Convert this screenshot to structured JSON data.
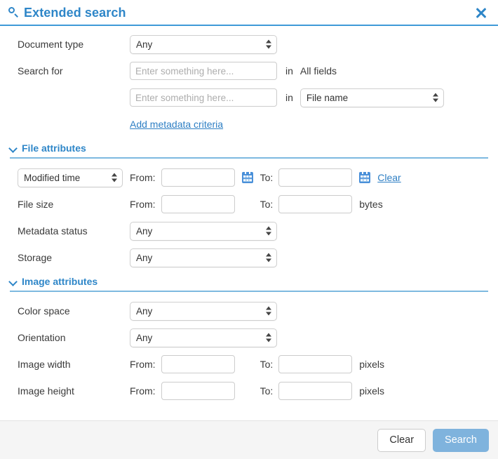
{
  "header": {
    "title": "Extended search",
    "search_icon": "search-icon",
    "close_icon": "close-icon"
  },
  "form": {
    "document_type": {
      "label": "Document type",
      "value": "Any"
    },
    "search_for": {
      "label": "Search for",
      "in_label": "in",
      "row1": {
        "placeholder": "Enter something here...",
        "value": "",
        "field_scope": "All fields"
      },
      "row2": {
        "placeholder": "Enter something here...",
        "value": "",
        "field_scope": "File name"
      },
      "add_criteria_link": "Add metadata criteria"
    }
  },
  "file_attributes": {
    "section_title": "File attributes",
    "chevron_icon": "chevron-down-icon",
    "date": {
      "field_value": "Modified time",
      "from_label": "From:",
      "from_value": "",
      "to_label": "To:",
      "to_value": "",
      "clear_link": "Clear",
      "calendar_icon": "calendar-icon"
    },
    "file_size": {
      "label": "File size",
      "from_label": "From:",
      "from_value": "",
      "to_label": "To:",
      "to_value": "",
      "unit": "bytes"
    },
    "metadata_status": {
      "label": "Metadata status",
      "value": "Any"
    },
    "storage": {
      "label": "Storage",
      "value": "Any"
    }
  },
  "image_attributes": {
    "section_title": "Image attributes",
    "chevron_icon": "chevron-down-icon",
    "color_space": {
      "label": "Color space",
      "value": "Any"
    },
    "orientation": {
      "label": "Orientation",
      "value": "Any"
    },
    "image_width": {
      "label": "Image width",
      "from_label": "From:",
      "from_value": "",
      "to_label": "To:",
      "to_value": "",
      "unit": "pixels"
    },
    "image_height": {
      "label": "Image height",
      "from_label": "From:",
      "from_value": "",
      "to_label": "To:",
      "to_value": "",
      "unit": "pixels"
    }
  },
  "footer": {
    "clear_label": "Clear",
    "search_label": "Search"
  },
  "colors": {
    "accent": "#2e86c8",
    "rule": "#7db9e0",
    "primary_button": "#7fb3dd",
    "footer_bg": "#f5f5f5"
  }
}
